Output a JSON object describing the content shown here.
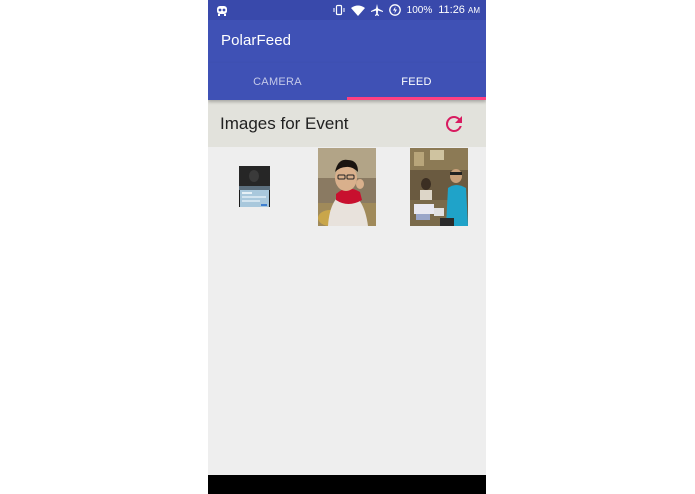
{
  "status_bar": {
    "battery": "100%",
    "time": "11:26",
    "ampm": "AM",
    "icons": [
      "robot-icon",
      "vibrate-icon",
      "wifi-icon",
      "airplane-icon",
      "battery-saver-icon"
    ]
  },
  "app": {
    "title": "PolarFeed"
  },
  "tabs": [
    {
      "label": "CAMERA",
      "selected": false
    },
    {
      "label": "FEED",
      "selected": true
    }
  ],
  "feed": {
    "header_title": "Images for Event",
    "refresh_icon": "refresh-icon",
    "photos": [
      {
        "name": "photo-laptop-screen"
      },
      {
        "name": "photo-person-red-hood"
      },
      {
        "name": "photo-people-at-table"
      }
    ]
  },
  "colors": {
    "status_bar": "#3949ab",
    "primary": "#3f51b5",
    "accent": "#ff4081",
    "refresh": "#d81b60",
    "background": "#eeeeee",
    "header_bg": "#e2e2dc"
  }
}
